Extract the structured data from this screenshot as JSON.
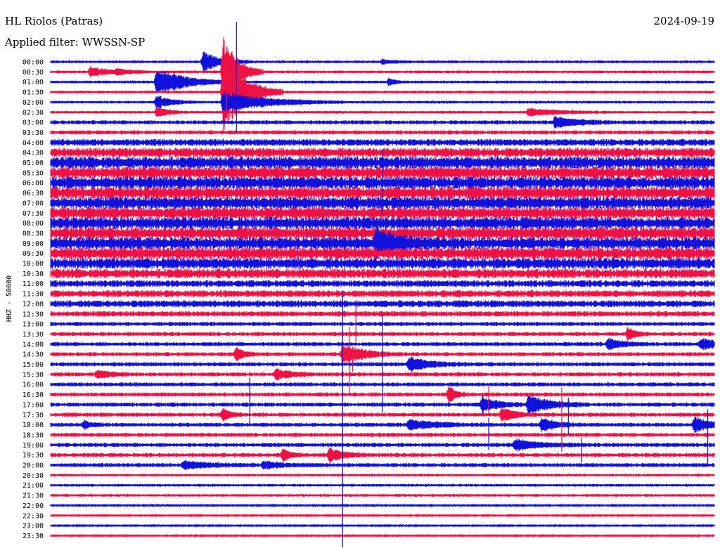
{
  "header": {
    "station": "HL Riolos (Patras)",
    "filter": "Applied filter: WWSSN-SP",
    "date": "2024-09-19"
  },
  "chart_data": {
    "type": "line",
    "title": "HL Riolos (Patras)",
    "subtitle": "Applied filter: WWSSN-SP",
    "date": "2024-09-19",
    "ylabel": "HHZ - 50000",
    "row_labels": [
      "00:00",
      "00:30",
      "01:00",
      "01:30",
      "02:00",
      "02:30",
      "03:00",
      "03:30",
      "04:00",
      "04:30",
      "05:00",
      "05:30",
      "06:00",
      "06:30",
      "07:00",
      "07:30",
      "08:00",
      "08:30",
      "09:00",
      "09:30",
      "10:00",
      "10:30",
      "11:00",
      "11:30",
      "12:00",
      "12:30",
      "13:00",
      "13:30",
      "14:00",
      "14:30",
      "15:00",
      "15:30",
      "16:00",
      "16:30",
      "17:00",
      "17:30",
      "18:00",
      "18:30",
      "19:00",
      "19:30",
      "20:00",
      "20:30",
      "21:00",
      "21:30",
      "22:00",
      "22:30",
      "23:00",
      "23:30"
    ],
    "trace_colors": [
      "#1111dd",
      "#ee1144"
    ],
    "noise_level": [
      2,
      2,
      2,
      2,
      2,
      2,
      3,
      3,
      5,
      7,
      9,
      9,
      9,
      9,
      9,
      9,
      9,
      9,
      9,
      9,
      8,
      7,
      5,
      5,
      5,
      4,
      3,
      3,
      3,
      3,
      3,
      3,
      3,
      3,
      3,
      3,
      3,
      3,
      3,
      3,
      3,
      2,
      2,
      2,
      2,
      1,
      1,
      1
    ],
    "events": [
      {
        "row": 0,
        "t": 0.23,
        "amp": 14,
        "dur": 0.025
      },
      {
        "row": 0,
        "t": 0.5,
        "amp": 3,
        "dur": 0.015
      },
      {
        "row": 1,
        "t": 0.06,
        "amp": 7,
        "dur": 0.03
      },
      {
        "row": 1,
        "t": 0.1,
        "amp": 3,
        "dur": 0.02
      },
      {
        "row": 1,
        "t": 0.26,
        "amp": 55,
        "dur": 0.02
      },
      {
        "row": 2,
        "t": 0.16,
        "amp": 20,
        "dur": 0.04
      },
      {
        "row": 2,
        "t": 0.51,
        "amp": 6,
        "dur": 0.01
      },
      {
        "row": 3,
        "t": 0.26,
        "amp": 60,
        "dur": 0.03
      },
      {
        "row": 4,
        "t": 0.16,
        "amp": 10,
        "dur": 0.02
      },
      {
        "row": 4,
        "t": 0.26,
        "amp": 16,
        "dur": 0.06
      },
      {
        "row": 5,
        "t": 0.16,
        "amp": 8,
        "dur": 0.015
      },
      {
        "row": 5,
        "t": 0.72,
        "amp": 6,
        "dur": 0.04
      },
      {
        "row": 6,
        "t": 0.76,
        "amp": 8,
        "dur": 0.03
      },
      {
        "row": 18,
        "t": 0.49,
        "amp": 18,
        "dur": 0.03
      },
      {
        "row": 27,
        "t": 0.87,
        "amp": 12,
        "dur": 0.01
      },
      {
        "row": 28,
        "t": 0.84,
        "amp": 8,
        "dur": 0.02
      },
      {
        "row": 28,
        "t": 0.98,
        "amp": 7,
        "dur": 0.03
      },
      {
        "row": 29,
        "t": 0.28,
        "amp": 10,
        "dur": 0.01
      },
      {
        "row": 29,
        "t": 0.44,
        "amp": 14,
        "dur": 0.03
      },
      {
        "row": 30,
        "t": 0.54,
        "amp": 10,
        "dur": 0.03
      },
      {
        "row": 31,
        "t": 0.34,
        "amp": 8,
        "dur": 0.02
      },
      {
        "row": 31,
        "t": 0.07,
        "amp": 6,
        "dur": 0.02
      },
      {
        "row": 33,
        "t": 0.6,
        "amp": 12,
        "dur": 0.01
      },
      {
        "row": 34,
        "t": 0.65,
        "amp": 12,
        "dur": 0.02
      },
      {
        "row": 34,
        "t": 0.72,
        "amp": 14,
        "dur": 0.03
      },
      {
        "row": 35,
        "t": 0.26,
        "amp": 10,
        "dur": 0.01
      },
      {
        "row": 35,
        "t": 0.68,
        "amp": 10,
        "dur": 0.02
      },
      {
        "row": 36,
        "t": 0.05,
        "amp": 6,
        "dur": 0.01
      },
      {
        "row": 36,
        "t": 0.54,
        "amp": 7,
        "dur": 0.04
      },
      {
        "row": 36,
        "t": 0.74,
        "amp": 10,
        "dur": 0.02
      },
      {
        "row": 36,
        "t": 0.97,
        "amp": 12,
        "dur": 0.02
      },
      {
        "row": 38,
        "t": 0.7,
        "amp": 8,
        "dur": 0.03
      },
      {
        "row": 39,
        "t": 0.35,
        "amp": 9,
        "dur": 0.01
      },
      {
        "row": 39,
        "t": 0.42,
        "amp": 10,
        "dur": 0.02
      },
      {
        "row": 40,
        "t": 0.2,
        "amp": 5,
        "dur": 0.04
      },
      {
        "row": 40,
        "t": 0.32,
        "amp": 5,
        "dur": 0.03
      }
    ],
    "spikes": [
      {
        "row": 0,
        "t": 0.28,
        "up": 57,
        "down": 100
      },
      {
        "row": 1,
        "t": 0.265,
        "up": 36,
        "down": 60
      },
      {
        "row": 12,
        "t": 0.5,
        "up": 48,
        "down": 46
      },
      {
        "row": 18,
        "t": 0.49,
        "up": 25,
        "down": 5
      },
      {
        "row": 24,
        "t": 0.44,
        "up": 18,
        "down": 355
      },
      {
        "row": 25,
        "t": 0.46,
        "up": 10,
        "down": 40
      },
      {
        "row": 26,
        "t": 0.5,
        "up": 14,
        "down": 126
      },
      {
        "row": 27,
        "t": 0.45,
        "up": 10,
        "down": 86
      },
      {
        "row": 29,
        "t": 0.455,
        "up": 10,
        "down": 25
      },
      {
        "row": 32,
        "t": 0.3,
        "up": 10,
        "down": 58
      },
      {
        "row": 33,
        "t": 0.66,
        "up": 12,
        "down": 30
      },
      {
        "row": 33,
        "t": 0.77,
        "up": 10,
        "down": 82
      },
      {
        "row": 34,
        "t": 0.78,
        "up": 10,
        "down": 42
      },
      {
        "row": 36,
        "t": 0.66,
        "up": 10,
        "down": 36
      },
      {
        "row": 36,
        "t": 0.99,
        "up": 22,
        "down": 58
      },
      {
        "row": 38,
        "t": 0.8,
        "up": 10,
        "down": 25
      }
    ]
  }
}
